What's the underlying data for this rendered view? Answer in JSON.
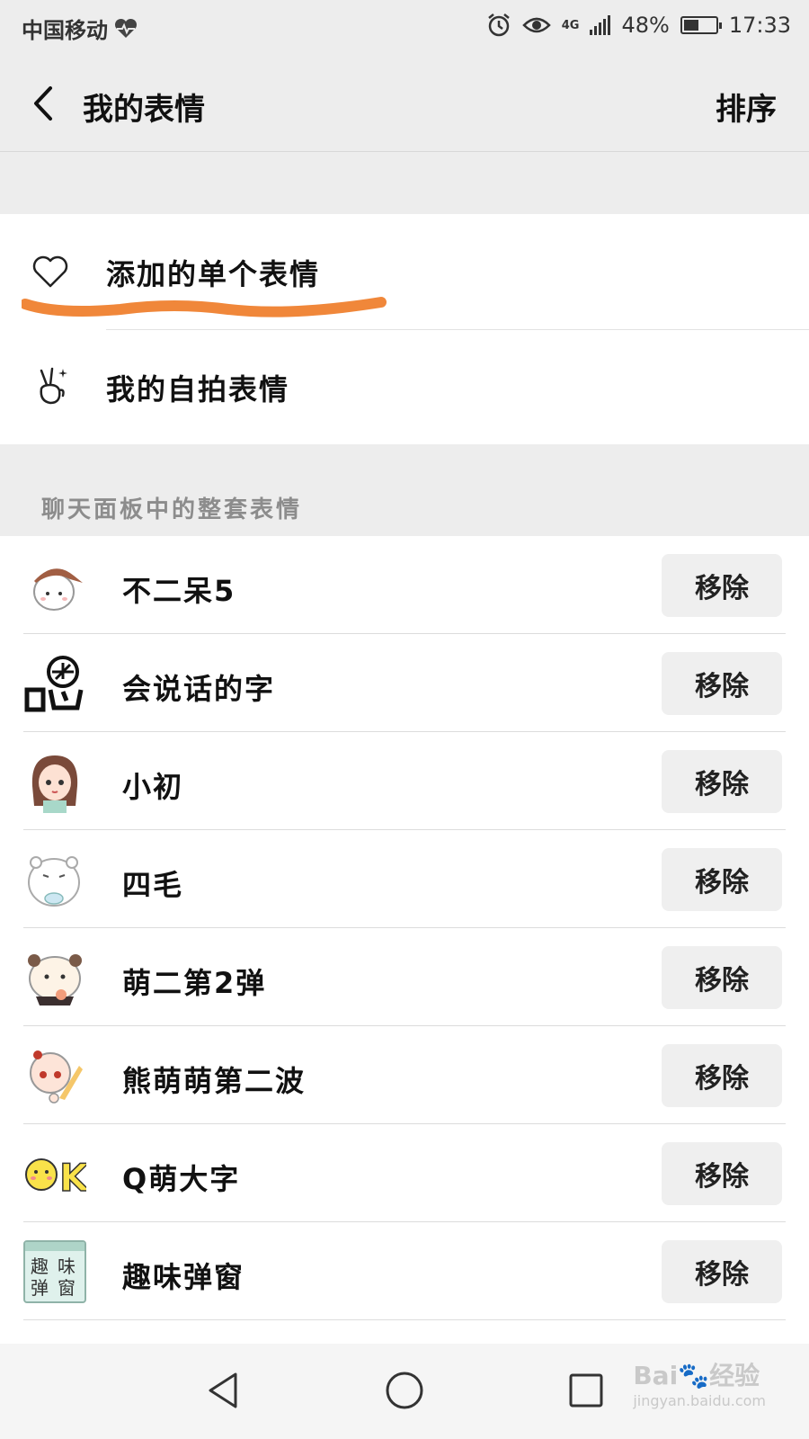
{
  "status_bar": {
    "carrier": "中国移动",
    "network": "4G",
    "battery_percent": "48%",
    "battery_level": 0.48,
    "time": "17:33"
  },
  "header": {
    "title": "我的表情",
    "sort_label": "排序"
  },
  "personal": {
    "items": [
      {
        "label": "添加的单个表情",
        "icon": "heart-icon"
      },
      {
        "label": "我的自拍表情",
        "icon": "victory-hand-icon"
      }
    ]
  },
  "section": {
    "title": "聊天面板中的整套表情"
  },
  "sticker_sets": [
    {
      "name": "不二呆5",
      "button": "移除",
      "thumb": "cat-with-cap-thumb"
    },
    {
      "name": "会说话的字",
      "button": "移除",
      "thumb": "talking-character-thumb"
    },
    {
      "name": "小初",
      "button": "移除",
      "thumb": "girl-thumb"
    },
    {
      "name": "四毛",
      "button": "移除",
      "thumb": "hamster-thumb"
    },
    {
      "name": "萌二第2弹",
      "button": "移除",
      "thumb": "panda-thumb"
    },
    {
      "name": "熊萌萌第二波",
      "button": "移除",
      "thumb": "baby-bear-thumb"
    },
    {
      "name": "Q萌大字",
      "button": "移除",
      "thumb": "ok-emoji-thumb"
    },
    {
      "name": "趣味弹窗",
      "button": "移除",
      "thumb": "popup-window-thumb"
    }
  ],
  "thumb_texts": {
    "popup": [
      "趣",
      "味",
      "弹",
      "窗"
    ],
    "ok": "K"
  },
  "colors": {
    "highlight_underline": "#f0873a",
    "background": "#ededed",
    "button_bg": "#efefef"
  },
  "watermark": {
    "brand": "Bai",
    "brand_suffix": "经验",
    "url": "jingyan.baidu.com"
  }
}
